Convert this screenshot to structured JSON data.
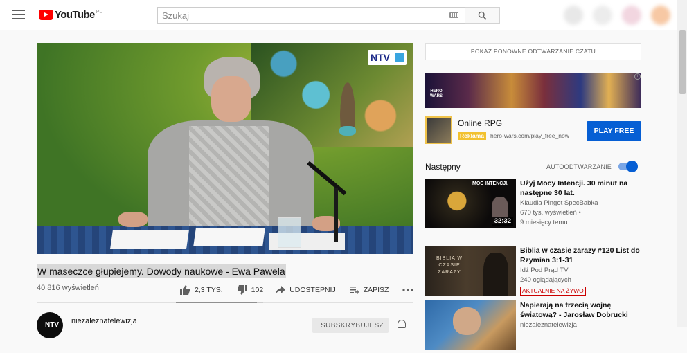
{
  "header": {
    "logo_text": "YouTube",
    "logo_region": "PL",
    "search_placeholder": "Szukaj"
  },
  "video": {
    "overlay_logo": "NTV",
    "title": "W maseczce głupiejemy. Dowody naukowe - Ewa Pawela",
    "views": "40 816 wyświetleń",
    "likes": "2,3 TYS.",
    "dislikes": "102",
    "share_label": "UDOSTĘPNIJ",
    "save_label": "ZAPISZ",
    "like_ratio": 0.93
  },
  "channel": {
    "avatar_text": "NTV",
    "name": "niezaleznatelewizja",
    "subscribe_label": "SUBSKRYBUJESZ"
  },
  "sidebar": {
    "replay_chat_label": "POKAŻ PONOWNE ODTWARZANIE CZATU",
    "ad": {
      "banner_text": "HERO WARS",
      "title": "Online RPG",
      "badge": "Reklama",
      "url": "hero-wars.com/play_free_now",
      "cta": "PLAY FREE"
    },
    "next_label": "Następny",
    "autoplay_label": "AUTOODTWARZANIE",
    "recommendations": [
      {
        "title": "Użyj Mocy Intencji. 30 minut na następne 30 lat.",
        "channel": "Klaudia Pingot SpecBabka",
        "views": "670 tys. wyświetleń •",
        "age": "9 miesięcy temu",
        "duration": "32:32",
        "thumb_text": "MOC INTENCJI."
      },
      {
        "title": "Biblia w czasie zarazy #120 List do Rzymian 3:1-31",
        "channel": "Idź Pod Prąd TV",
        "views": "240 oglądających",
        "badge": "AKTUALNIE NA ŻYWO",
        "thumb_text": "BIBLIA W CZASIE ZARAZY"
      },
      {
        "title": "Napierają na trzecią wojnę światową? - Jarosław Dobrucki",
        "channel": "niezaleznatelewizja"
      }
    ]
  }
}
